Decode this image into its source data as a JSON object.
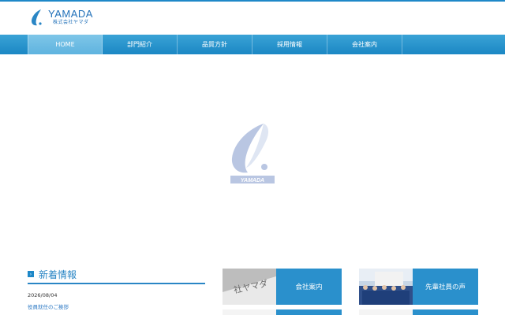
{
  "header": {
    "logo_name": "YAMADA",
    "logo_sub": "株式会社ヤマダ"
  },
  "nav": {
    "items": [
      {
        "label": "HOME",
        "active": true
      },
      {
        "label": "部門紹介",
        "active": false
      },
      {
        "label": "品質方針",
        "active": false
      },
      {
        "label": "採用情報",
        "active": false
      },
      {
        "label": "会社案内",
        "active": false
      }
    ]
  },
  "hero": {
    "logo_text": "YAMADA"
  },
  "news": {
    "title": "新着情報",
    "items": [
      {
        "date": "2026/08/04",
        "title": "役員就任のご挨拶"
      }
    ]
  },
  "cards": [
    {
      "label": "会社案内"
    },
    {
      "label": "先輩社員の声"
    }
  ],
  "colors": {
    "accent": "#1e88c8",
    "nav_active": "#6dbde4",
    "card": "#2a90cc"
  }
}
